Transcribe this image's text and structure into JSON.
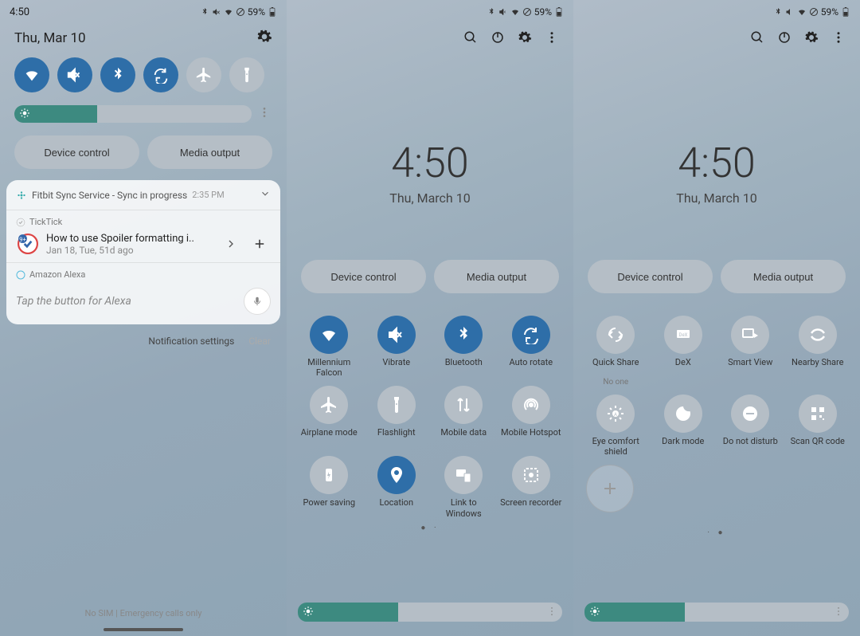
{
  "status": {
    "time": "4:50",
    "battery": "59%"
  },
  "screen1": {
    "date": "Thu, Mar 10",
    "device_control": "Device control",
    "media_output": "Media output",
    "brightness_pct": 35,
    "fitbit": {
      "title": "Fitbit Sync Service - Sync in progress",
      "time": "2:35 PM"
    },
    "ticktick": {
      "app": "TickTick",
      "title": "How to use Spoiler formatting i..",
      "sub": "Jan 18, Tue, 51d ago"
    },
    "alexa": {
      "app": "Amazon Alexa",
      "placeholder": "Tap the button for Alexa"
    },
    "notif_settings": "Notification settings",
    "clear": "Clear",
    "bottom": "No SIM | Emergency calls only"
  },
  "expanded": {
    "time": "4:50",
    "date": "Thu, March 10",
    "device_control": "Device control",
    "media_output": "Media output",
    "brightness_pct": 38
  },
  "page1_tiles": [
    {
      "key": "wifi",
      "label": "Millennium Falcon",
      "active": true
    },
    {
      "key": "vibrate",
      "label": "Vibrate",
      "active": true
    },
    {
      "key": "bluetooth",
      "label": "Bluetooth",
      "active": true
    },
    {
      "key": "autorotate",
      "label": "Auto rotate",
      "active": true
    },
    {
      "key": "airplane",
      "label": "Airplane mode",
      "active": false
    },
    {
      "key": "flashlight",
      "label": "Flashlight",
      "active": false
    },
    {
      "key": "mobiledata",
      "label": "Mobile data",
      "active": false
    },
    {
      "key": "hotspot",
      "label": "Mobile Hotspot",
      "active": false
    },
    {
      "key": "powersaving",
      "label": "Power saving",
      "active": false
    },
    {
      "key": "location",
      "label": "Location",
      "active": true
    },
    {
      "key": "linkwindows",
      "label": "Link to Windows",
      "active": false
    },
    {
      "key": "screenrec",
      "label": "Screen recorder",
      "active": false
    }
  ],
  "page2_tiles": [
    {
      "key": "quickshare",
      "label": "Quick Share",
      "sub": "No one",
      "active": false
    },
    {
      "key": "dex",
      "label": "DeX",
      "active": false
    },
    {
      "key": "smartview",
      "label": "Smart View",
      "active": false
    },
    {
      "key": "nearbyshare",
      "label": "Nearby Share",
      "active": false
    },
    {
      "key": "eyecomfort",
      "label": "Eye comfort shield",
      "active": false
    },
    {
      "key": "darkmode",
      "label": "Dark mode",
      "active": false
    },
    {
      "key": "dnd",
      "label": "Do not disturb",
      "active": false
    },
    {
      "key": "scanqr",
      "label": "Scan QR code",
      "active": false
    }
  ]
}
